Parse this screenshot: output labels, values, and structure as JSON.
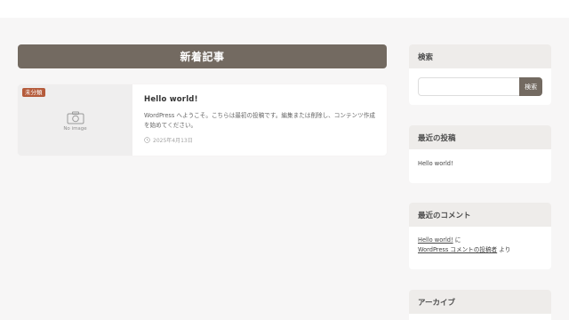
{
  "main": {
    "section_title": "新着記事",
    "post": {
      "category": "未分類",
      "thumbnail_text": "No image",
      "thumbnail_icon": "camera-icon",
      "title": "Hello world!",
      "excerpt": "WordPress へようこそ。こちらは最初の投稿です。編集または削除し、コンテンツ作成を始めてください。",
      "date": "2025年4月13日",
      "date_icon": "clock-icon"
    }
  },
  "sidebar": {
    "search": {
      "title": "検索",
      "placeholder": "",
      "button_label": "検索"
    },
    "recent_posts": {
      "title": "最近の投稿",
      "items": [
        "Hello world!"
      ]
    },
    "recent_comments": {
      "title": "最近のコメント",
      "post_link": "Hello world!",
      "joiner": "に",
      "author_link": "WordPress コメントの投稿者",
      "suffix": "より"
    },
    "archives": {
      "title": "アーカイブ"
    }
  },
  "colors": {
    "accent": "#736a61",
    "category_badge": "#b55b3b",
    "background": "#f7f6f6"
  }
}
